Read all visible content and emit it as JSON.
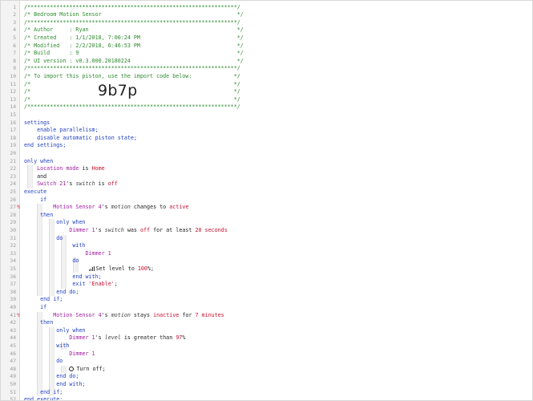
{
  "piston_code": "9b7p",
  "lines": [
    {
      "n": "1",
      "parts": [
        [
          "cm",
          "/*****************************************************************/"
        ]
      ]
    },
    {
      "n": "2",
      "parts": [
        [
          "cm",
          "/* Bedroom Motion Sensor                                          */"
        ]
      ]
    },
    {
      "n": "3",
      "parts": [
        [
          "cm",
          "/*****************************************************************/"
        ]
      ]
    },
    {
      "n": "4",
      "parts": [
        [
          "cm",
          "/* Author     : Ryan                                              */"
        ]
      ]
    },
    {
      "n": "5",
      "parts": [
        [
          "cm",
          "/* Created    : 1/1/2018, 7:00:24 PM                              */"
        ]
      ]
    },
    {
      "n": "6",
      "parts": [
        [
          "cm",
          "/* Modified   : 2/2/2018, 6:46:53 PM                              */"
        ]
      ]
    },
    {
      "n": "7",
      "parts": [
        [
          "cm",
          "/* Build      : 9                                                 */"
        ]
      ]
    },
    {
      "n": "8",
      "parts": [
        [
          "cm",
          "/* UI version : v0.3.000.20180224                                 */"
        ]
      ]
    },
    {
      "n": "9",
      "parts": [
        [
          "cm",
          "/*****************************************************************/"
        ]
      ]
    },
    {
      "n": "10",
      "parts": [
        [
          "cm",
          "/* To import this piston, use the import code below:             */"
        ]
      ]
    },
    {
      "n": "11",
      "parts": [
        [
          "cm",
          "/*                                                               */"
        ]
      ]
    },
    {
      "n": "12",
      "parts": [
        [
          "cm",
          "/*                                                               */"
        ]
      ]
    },
    {
      "n": "13",
      "parts": [
        [
          "cm",
          "/*                                                               */"
        ]
      ]
    },
    {
      "n": "14",
      "parts": [
        [
          "cm",
          "/*****************************************************************/"
        ]
      ]
    },
    {
      "n": "15",
      "parts": []
    },
    {
      "n": "16",
      "parts": [
        [
          "kw",
          "settings"
        ]
      ]
    },
    {
      "n": "17",
      "parts": [
        [
          "kw",
          "    enable parallelism;"
        ]
      ]
    },
    {
      "n": "18",
      "parts": [
        [
          "kw",
          "    disable automatic piston state;"
        ]
      ]
    },
    {
      "n": "19",
      "parts": [
        [
          "kw",
          "end settings;"
        ]
      ]
    },
    {
      "n": "20",
      "parts": []
    },
    {
      "n": "21",
      "parts": [
        [
          "kw",
          "only when"
        ]
      ]
    },
    {
      "n": "22",
      "parts": [
        [
          "dev",
          "    Location mode"
        ],
        [
          "txt",
          " is "
        ],
        [
          "val",
          "Home"
        ]
      ]
    },
    {
      "n": "23",
      "parts": [
        [
          "txt",
          "    and"
        ]
      ]
    },
    {
      "n": "24",
      "parts": [
        [
          "dev",
          "    Switch 21"
        ],
        [
          "txt",
          "'s "
        ],
        [
          "attr",
          "switch"
        ],
        [
          "txt",
          " is "
        ],
        [
          "val",
          "off"
        ]
      ]
    },
    {
      "n": "25",
      "parts": [
        [
          "kw",
          "execute"
        ]
      ]
    },
    {
      "n": "26",
      "parts": [
        [
          "kw",
          "     if"
        ]
      ]
    },
    {
      "n": "27",
      "bp": true,
      "parts": [
        [
          "dev",
          "         Motion Sensor 4"
        ],
        [
          "txt",
          "'s "
        ],
        [
          "attr",
          "motion"
        ],
        [
          "txt",
          " changes to "
        ],
        [
          "val",
          "active"
        ]
      ]
    },
    {
      "n": "28",
      "parts": [
        [
          "kw",
          "     then"
        ]
      ]
    },
    {
      "n": "29",
      "parts": [
        [
          "kw",
          "          only when"
        ]
      ]
    },
    {
      "n": "30",
      "parts": [
        [
          "dev",
          "              Dimmer 1"
        ],
        [
          "txt",
          "'s "
        ],
        [
          "attr",
          "switch"
        ],
        [
          "txt",
          " was "
        ],
        [
          "val",
          "off"
        ],
        [
          "txt",
          " for at least "
        ],
        [
          "num",
          "20"
        ],
        [
          "txt",
          " "
        ],
        [
          "val",
          "seconds"
        ]
      ]
    },
    {
      "n": "31",
      "parts": [
        [
          "kw",
          "          do"
        ]
      ]
    },
    {
      "n": "32",
      "parts": [
        [
          "kw",
          "               with"
        ]
      ]
    },
    {
      "n": "33",
      "parts": [
        [
          "dev",
          "                   Dimmer 1"
        ]
      ]
    },
    {
      "n": "34",
      "parts": [
        [
          "kw",
          "               do"
        ]
      ]
    },
    {
      "n": "35",
      "parts": [
        [
          "icon",
          "                    bars"
        ],
        [
          "txt",
          "Set level to "
        ],
        [
          "num",
          "100"
        ],
        [
          "txt",
          "%;"
        ]
      ]
    },
    {
      "n": "36",
      "parts": [
        [
          "kw",
          "               end with;"
        ]
      ]
    },
    {
      "n": "37",
      "parts": [
        [
          "kw",
          "               exit "
        ],
        [
          "val",
          "'Enable'"
        ],
        [
          "txt",
          ";"
        ]
      ]
    },
    {
      "n": "38",
      "parts": [
        [
          "kw",
          "          end do;"
        ]
      ]
    },
    {
      "n": "39",
      "parts": [
        [
          "kw",
          "     end if;"
        ]
      ]
    },
    {
      "n": "40",
      "parts": [
        [
          "kw",
          "     if"
        ]
      ]
    },
    {
      "n": "41",
      "bp": true,
      "parts": [
        [
          "dev",
          "         Motion Sensor 4"
        ],
        [
          "txt",
          "'s "
        ],
        [
          "attr",
          "motion"
        ],
        [
          "txt",
          " stays "
        ],
        [
          "val",
          "inactive"
        ],
        [
          "txt",
          " for "
        ],
        [
          "num",
          "7"
        ],
        [
          "txt",
          " "
        ],
        [
          "val",
          "minutes"
        ]
      ]
    },
    {
      "n": "42",
      "parts": [
        [
          "kw",
          "     then"
        ]
      ]
    },
    {
      "n": "43",
      "parts": [
        [
          "kw",
          "          only when"
        ]
      ]
    },
    {
      "n": "44",
      "parts": [
        [
          "dev",
          "              Dimmer 1"
        ],
        [
          "txt",
          "'s "
        ],
        [
          "attr",
          "level"
        ],
        [
          "txt",
          " is greater than "
        ],
        [
          "num",
          "97"
        ],
        [
          "txt",
          "%"
        ]
      ]
    },
    {
      "n": "45",
      "parts": [
        [
          "kw",
          "          with"
        ]
      ]
    },
    {
      "n": "46",
      "parts": [
        [
          "dev",
          "              Dimmer 1"
        ]
      ]
    },
    {
      "n": "47",
      "parts": [
        [
          "kw",
          "          do"
        ]
      ]
    },
    {
      "n": "48",
      "parts": [
        [
          "icon",
          "              ring"
        ],
        [
          "txt",
          "Turn off;"
        ]
      ]
    },
    {
      "n": "49",
      "parts": [
        [
          "kw",
          "          end do;"
        ]
      ]
    },
    {
      "n": "50",
      "parts": [
        [
          "kw",
          "          end with;"
        ]
      ]
    },
    {
      "n": "51",
      "parts": [
        [
          "kw",
          "     end if;"
        ]
      ]
    },
    {
      "n": "52",
      "parts": [
        [
          "kw",
          "end execute;"
        ]
      ]
    }
  ]
}
